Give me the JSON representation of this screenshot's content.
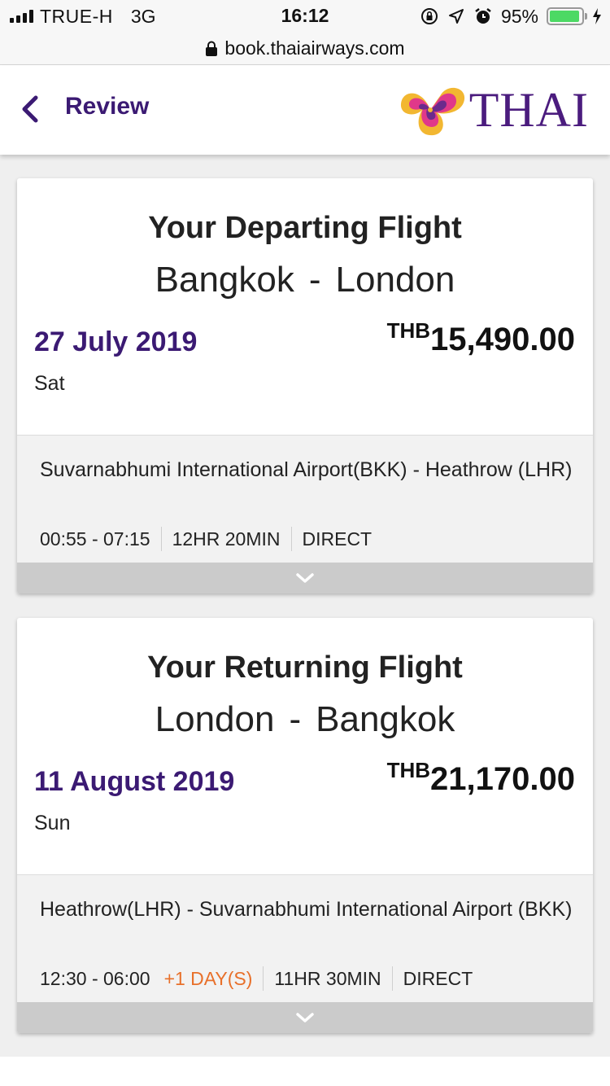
{
  "status_bar": {
    "carrier": "TRUE-H",
    "network": "3G",
    "time": "16:12",
    "battery": "95%",
    "battery_level": 0.95,
    "icons": [
      "signal-icon",
      "orientation-lock-icon",
      "location-icon",
      "alarm-icon",
      "battery-icon",
      "charging-icon"
    ]
  },
  "browser": {
    "url": "book.thaiairways.com",
    "icon": "lock-icon"
  },
  "header": {
    "back_icon": "chevron-left-icon",
    "title": "Review",
    "logo_text": "THAI",
    "logo_icon": "thai-orchid-logo"
  },
  "flights": [
    {
      "heading": "Your Departing Flight",
      "origin": "Bangkok",
      "separator": "-",
      "destination": "London",
      "date": "27 July 2019",
      "day": "Sat",
      "currency": "THB",
      "price": "15,490.00",
      "airports": "Suvarnabhumi International Airport(BKK) - Heathrow (LHR)",
      "times": "00:55 - 07:15",
      "next_day": "",
      "duration": "12HR 20MIN",
      "stops": "DIRECT",
      "expand_icon": "chevron-down-icon"
    },
    {
      "heading": "Your Returning Flight",
      "origin": "London",
      "separator": "-",
      "destination": "Bangkok",
      "date": "11 August 2019",
      "day": "Sun",
      "currency": "THB",
      "price": "21,170.00",
      "airports": "Heathrow(LHR) - Suvarnabhumi International Airport (BKK)",
      "times": "12:30 - 06:00",
      "next_day": "+1 DAY(S)",
      "duration": "11HR 30MIN",
      "stops": "DIRECT",
      "expand_icon": "chevron-down-icon"
    }
  ],
  "colors": {
    "brand_purple": "#3b1a73",
    "next_day_orange": "#e8702a",
    "battery_green": "#4cd964"
  }
}
